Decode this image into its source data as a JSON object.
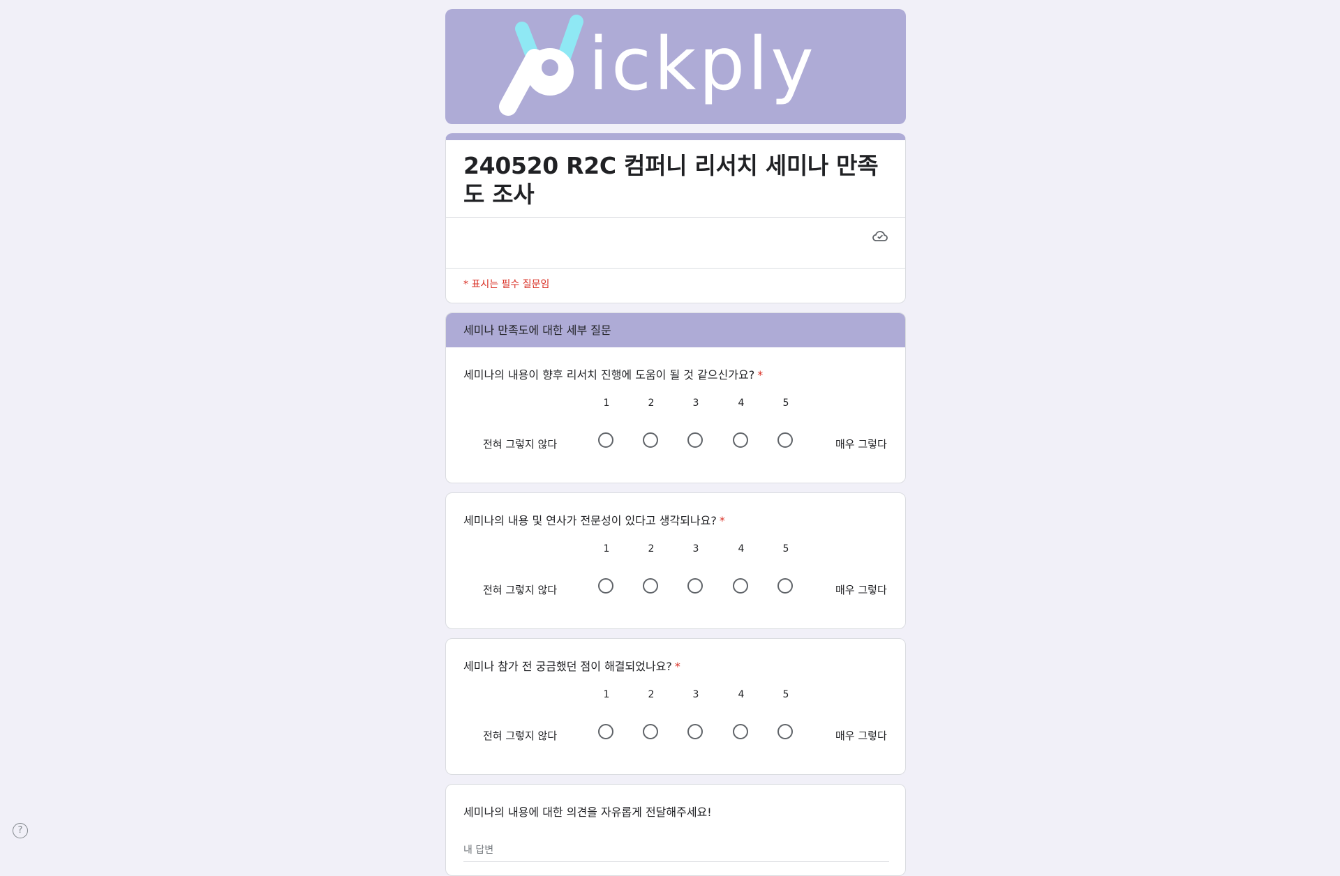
{
  "banner": {
    "logo_text": "pickply"
  },
  "form": {
    "title": "240520 R2C 컴퍼니 리서치 세미나 만족도 조사",
    "required_note": "* 표시는 필수 질문임"
  },
  "section": {
    "title": "세미나 만족도에 대한 세부 질문"
  },
  "scale": {
    "numbers": [
      "1",
      "2",
      "3",
      "4",
      "5"
    ],
    "low_label": "전혀 그렇지 않다",
    "high_label": "매우 그렇다"
  },
  "questions": [
    {
      "title": "세미나의 내용이 향후 리서치 진행에 도움이 될 것 같으신가요?",
      "required": "*"
    },
    {
      "title": "세미나의 내용 및 연사가 전문성이 있다고 생각되나요?",
      "required": "*"
    },
    {
      "title": "세미나 참가 전 궁금했던 점이 해결되었나요?",
      "required": "*"
    }
  ],
  "text_question": {
    "title": "세미나의 내용에 대한 의견을 자유롭게 전달해주세요!",
    "placeholder": "내 답변"
  },
  "help": {
    "label": "?"
  },
  "colors": {
    "accent": "#aeabd6",
    "required": "#d93025",
    "banner_logo": "#ffffff",
    "banner_logo_accent": "#8fe8f4"
  }
}
